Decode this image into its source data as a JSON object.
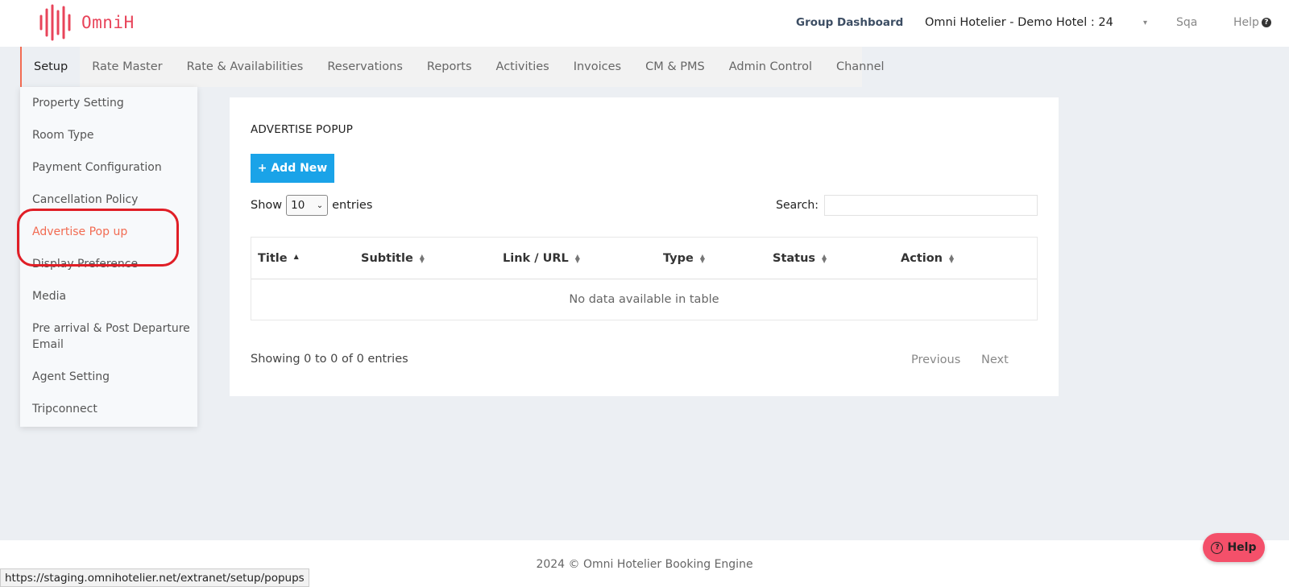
{
  "brand": {
    "logo_text": "OmniH",
    "color": "#e8445a"
  },
  "topbar": {
    "group_dashboard": "Group Dashboard",
    "hotel": "Omni Hotelier - Demo Hotel : 24",
    "caret": "▾",
    "user": "Sqa",
    "help": "Help",
    "help_icon": "question-circle-icon"
  },
  "nav": {
    "accent": "#f26b52",
    "items": [
      "Setup",
      "Rate Master",
      "Rate & Availabilities",
      "Reservations",
      "Reports",
      "Activities",
      "Invoices",
      "CM & PMS",
      "Admin Control",
      "Channel"
    ],
    "active": "Setup"
  },
  "submenu": {
    "items": [
      "Property Setting",
      "Room Type",
      "Payment Configuration",
      "Cancellation Policy",
      "Advertise Pop up",
      "Display Preference",
      "Media",
      "Pre arrival & Post Departure Email",
      "Agent Setting",
      "Tripconnect"
    ],
    "active": "Advertise Pop up",
    "annotation_color": "#e01e26"
  },
  "panel": {
    "title": "ADVERTISE POPUP",
    "add_button": "+ Add New",
    "add_button_color": "#1aa3e8",
    "show_label": "Show",
    "entries_value": "10",
    "entries_label": "entries",
    "search_label": "Search:",
    "search_value": ""
  },
  "table": {
    "columns": [
      "Title",
      "Subtitle",
      "Link / URL",
      "Type",
      "Status",
      "Action"
    ],
    "sort_column": "Title",
    "empty_text": "No data available in table"
  },
  "pagination": {
    "info": "Showing 0 to 0 of 0 entries",
    "previous": "Previous",
    "next": "Next"
  },
  "footer": {
    "text": "2024 © Omni Hotelier Booking Engine"
  },
  "help_fab": {
    "label": "Help",
    "color": "#f4506a"
  },
  "status_bar": {
    "url": "https://staging.omnihotelier.net/extranet/setup/popups"
  }
}
